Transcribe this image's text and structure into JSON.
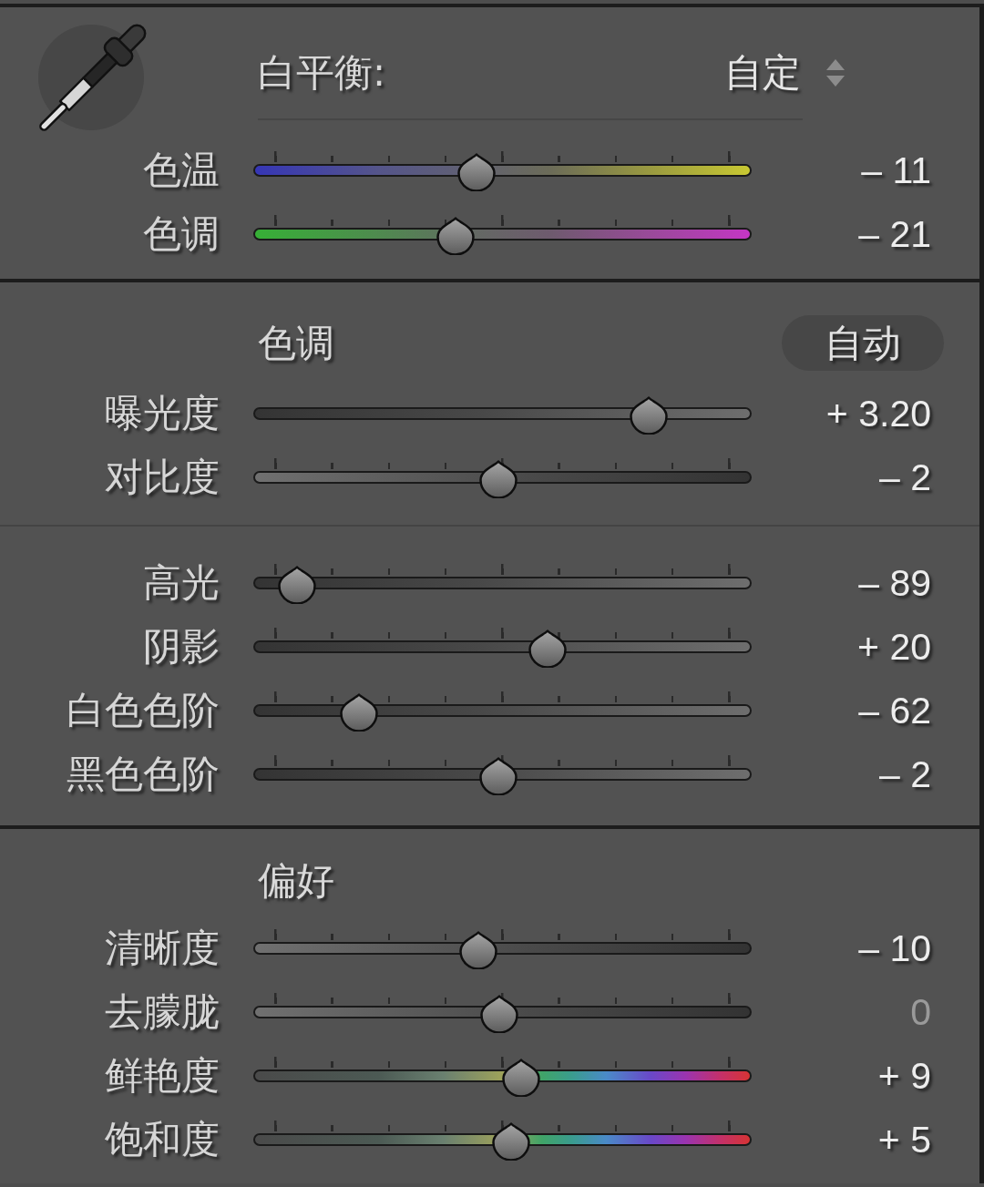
{
  "white_balance": {
    "label": "白平衡:",
    "preset": "自定",
    "sliders": [
      {
        "label": "色温",
        "kind": "temperature",
        "ticks": true,
        "level": 0.448,
        "reading": "– 11",
        "dimmed": false
      },
      {
        "label": "色调",
        "kind": "tint",
        "ticks": true,
        "level": 0.406,
        "reading": "– 21",
        "dimmed": false
      }
    ]
  },
  "tone": {
    "title": "色调",
    "auto_button": "自动",
    "groups": [
      {
        "sliders": [
          {
            "label": "曝光度",
            "kind": "dark-to-light",
            "ticks": false,
            "level": 0.794,
            "reading": "+ 3.20",
            "dimmed": false
          },
          {
            "label": "对比度",
            "kind": "light-to-dark",
            "ticks": true,
            "level": 0.492,
            "reading": "– 2",
            "dimmed": false
          }
        ]
      },
      {
        "sliders": [
          {
            "label": "高光",
            "kind": "dark-to-light",
            "ticks": true,
            "level": 0.088,
            "reading": "– 89",
            "dimmed": false
          },
          {
            "label": "阴影",
            "kind": "dark-to-light",
            "ticks": true,
            "level": 0.591,
            "reading": "+ 20",
            "dimmed": false
          },
          {
            "label": "白色色阶",
            "kind": "dark-to-light",
            "ticks": true,
            "level": 0.212,
            "reading": "– 62",
            "dimmed": false
          },
          {
            "label": "黑色色阶",
            "kind": "dark-to-light",
            "ticks": true,
            "level": 0.492,
            "reading": "– 2",
            "dimmed": false
          }
        ]
      }
    ]
  },
  "presence": {
    "title": "偏好",
    "sliders": [
      {
        "label": "清晰度",
        "kind": "light-to-dark",
        "ticks": true,
        "level": 0.451,
        "reading": "– 10",
        "dimmed": false
      },
      {
        "label": "去朦胧",
        "kind": "light-to-dark",
        "ticks": true,
        "level": 0.494,
        "reading": "0",
        "dimmed": true
      },
      {
        "label": "鲜艳度",
        "kind": "spectrum",
        "ticks": true,
        "level": 0.538,
        "reading": "+ 9",
        "dimmed": false
      },
      {
        "label": "饱和度",
        "kind": "spectrum",
        "ticks": true,
        "level": 0.518,
        "reading": "+ 5",
        "dimmed": false
      }
    ]
  }
}
